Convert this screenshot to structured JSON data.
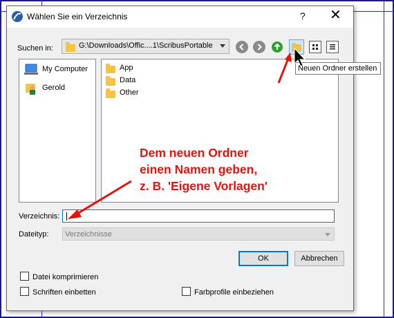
{
  "dialog": {
    "title": "Wählen Sie ein Verzeichnis",
    "help_label": "?",
    "close_label": "✕"
  },
  "lookin": {
    "label": "Suchen in:",
    "path": "G:\\Downloads\\Offic....1\\ScribusPortable"
  },
  "toolbar": {
    "back_icon": "back-arrow-icon",
    "forward_icon": "forward-arrow-icon",
    "up_icon": "up-arrow-icon",
    "new_folder_icon": "new-folder-icon",
    "icon_view_icon": "icon-view-icon",
    "detail_view_icon": "detail-view-icon"
  },
  "tooltip": "Neuen Ordner erstellen",
  "sidebar": {
    "items": [
      {
        "label": "My Computer",
        "icon": "computer-icon"
      },
      {
        "label": "Gerold",
        "icon": "user-folder-icon"
      }
    ]
  },
  "files": {
    "items": [
      {
        "label": "App",
        "icon": "folder-icon"
      },
      {
        "label": "Data",
        "icon": "folder-icon"
      },
      {
        "label": "Other",
        "icon": "folder-icon"
      }
    ]
  },
  "annotation": {
    "lines": [
      "Dem neuen Ordner",
      "einen Namen geben,",
      "z. B. 'Eigene Vorlagen'"
    ],
    "color": "#e8120c"
  },
  "directory": {
    "label": "Verzeichnis:",
    "value": ""
  },
  "filetype": {
    "label": "Dateityp:",
    "value": "Verzeichnisse"
  },
  "buttons": {
    "ok": "OK",
    "cancel": "Abbrechen"
  },
  "options": {
    "compress": "Datei komprimieren",
    "embed_fonts": "Schriften einbetten",
    "color_profiles": "Farbprofile einbeziehen"
  }
}
